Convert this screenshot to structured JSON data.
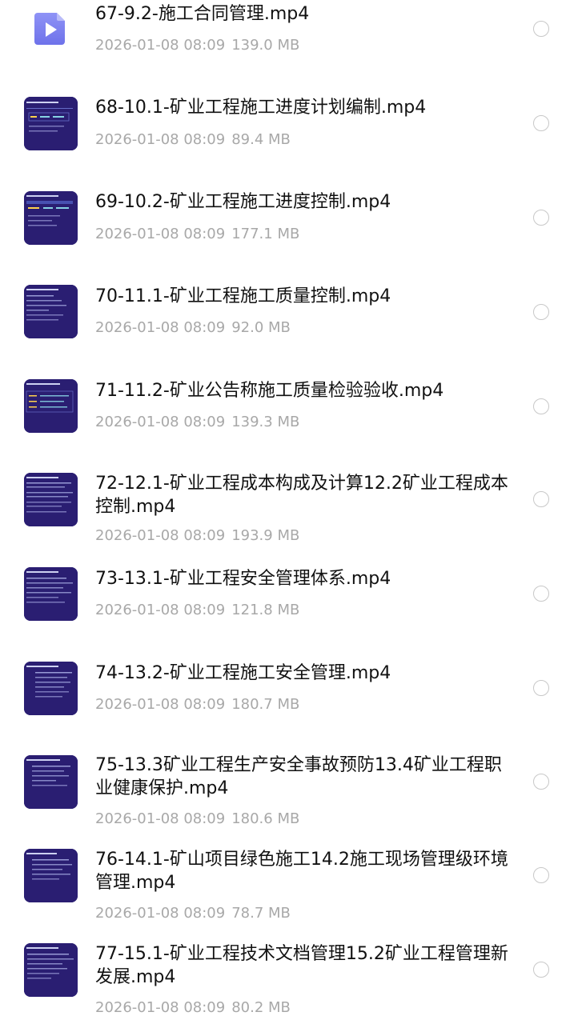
{
  "files": [
    {
      "name": "67-9.2-施工合同管理.mp4",
      "date": "2026-01-08 08:09",
      "size": "139.0 MB",
      "thumbnail": "video-file-icon",
      "selected": false
    },
    {
      "name": "68-10.1-矿业工程施工进度计划编制.mp4",
      "date": "2026-01-08 08:09",
      "size": "89.4 MB",
      "thumbnail": "video-thumbnail",
      "selected": false
    },
    {
      "name": "69-10.2-矿业工程施工进度控制.mp4",
      "date": "2026-01-08 08:09",
      "size": "177.1 MB",
      "thumbnail": "video-thumbnail",
      "selected": false
    },
    {
      "name": "70-11.1-矿业工程施工质量控制.mp4",
      "date": "2026-01-08 08:09",
      "size": "92.0 MB",
      "thumbnail": "video-thumbnail",
      "selected": false
    },
    {
      "name": "71-11.2-矿业公告称施工质量检验验收.mp4",
      "date": "2026-01-08 08:09",
      "size": "139.3 MB",
      "thumbnail": "video-thumbnail",
      "selected": false
    },
    {
      "name": "72-12.1-矿业工程成本构成及计算12.2矿业工程成本控制.mp4",
      "date": "2026-01-08 08:09",
      "size": "193.9 MB",
      "thumbnail": "video-thumbnail",
      "selected": false
    },
    {
      "name": "73-13.1-矿业工程安全管理体系.mp4",
      "date": "2026-01-08 08:09",
      "size": "121.8 MB",
      "thumbnail": "video-thumbnail",
      "selected": false
    },
    {
      "name": "74-13.2-矿业工程施工安全管理.mp4",
      "date": "2026-01-08 08:09",
      "size": "180.7 MB",
      "thumbnail": "video-thumbnail",
      "selected": false
    },
    {
      "name": "75-13.3矿业工程生产安全事故预防13.4矿业工程职业健康保护.mp4",
      "date": "2026-01-08 08:09",
      "size": "180.6 MB",
      "thumbnail": "video-thumbnail",
      "selected": false
    },
    {
      "name": "76-14.1-矿山项目绿色施工14.2施工现场管理级环境管理.mp4",
      "date": "2026-01-08 08:09",
      "size": "78.7 MB",
      "thumbnail": "video-thumbnail",
      "selected": false
    },
    {
      "name": "77-15.1-矿业工程技术文档管理15.2矿业工程管理新发展.mp4",
      "date": "2026-01-08 08:09",
      "size": "80.2 MB",
      "thumbnail": "video-thumbnail",
      "selected": false
    }
  ],
  "colors": {
    "title_text": "#111111",
    "meta_text": "#a8a8a8",
    "radio_border": "#c8c8c8",
    "video_icon": "#7b7ff0",
    "thumbnail_bg": "#2b1f75"
  }
}
